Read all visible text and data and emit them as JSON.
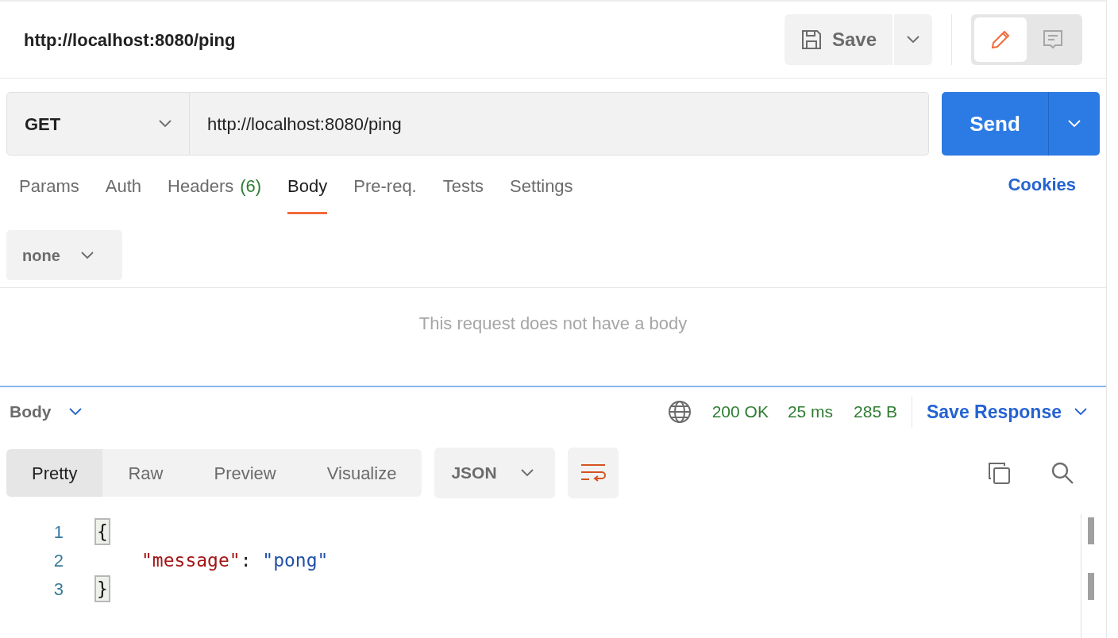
{
  "request_title": "http://localhost:8080/ping",
  "save": {
    "label": "Save"
  },
  "mode_toggle": [
    {
      "kind": "edit",
      "selected": true
    },
    {
      "kind": "comments",
      "selected": false
    }
  ],
  "method": "GET",
  "url": "http://localhost:8080/ping",
  "send": "Send",
  "request_tabs": [
    {
      "label": "Params",
      "selected": false
    },
    {
      "label": "Auth",
      "selected": false
    },
    {
      "label": "Headers",
      "count": "(6)",
      "selected": false
    },
    {
      "label": "Body",
      "selected": true
    },
    {
      "label": "Pre-req.",
      "selected": false
    },
    {
      "label": "Tests",
      "selected": false
    },
    {
      "label": "Settings",
      "selected": false
    }
  ],
  "cookies": "Cookies",
  "body_type": "none",
  "empty_message": "This request does not have a body",
  "response": {
    "section": "Body",
    "status": "200 OK",
    "time": "25 ms",
    "size": "285 B",
    "save_response": "Save Response",
    "view_tabs": [
      {
        "label": "Pretty",
        "selected": true
      },
      {
        "label": "Raw",
        "selected": false
      },
      {
        "label": "Preview",
        "selected": false
      },
      {
        "label": "Visualize",
        "selected": false
      }
    ],
    "format": "JSON",
    "lines": [
      {
        "number": "1",
        "tokens": [
          {
            "kind": "brace",
            "text": "{"
          }
        ]
      },
      {
        "number": "2",
        "tokens": [
          {
            "kind": "key",
            "text": "\"message\""
          },
          {
            "kind": "punct",
            "text": ": "
          },
          {
            "kind": "string",
            "text": "\"pong\""
          }
        ]
      },
      {
        "number": "3",
        "tokens": [
          {
            "kind": "brace",
            "text": "}"
          }
        ]
      }
    ]
  }
}
